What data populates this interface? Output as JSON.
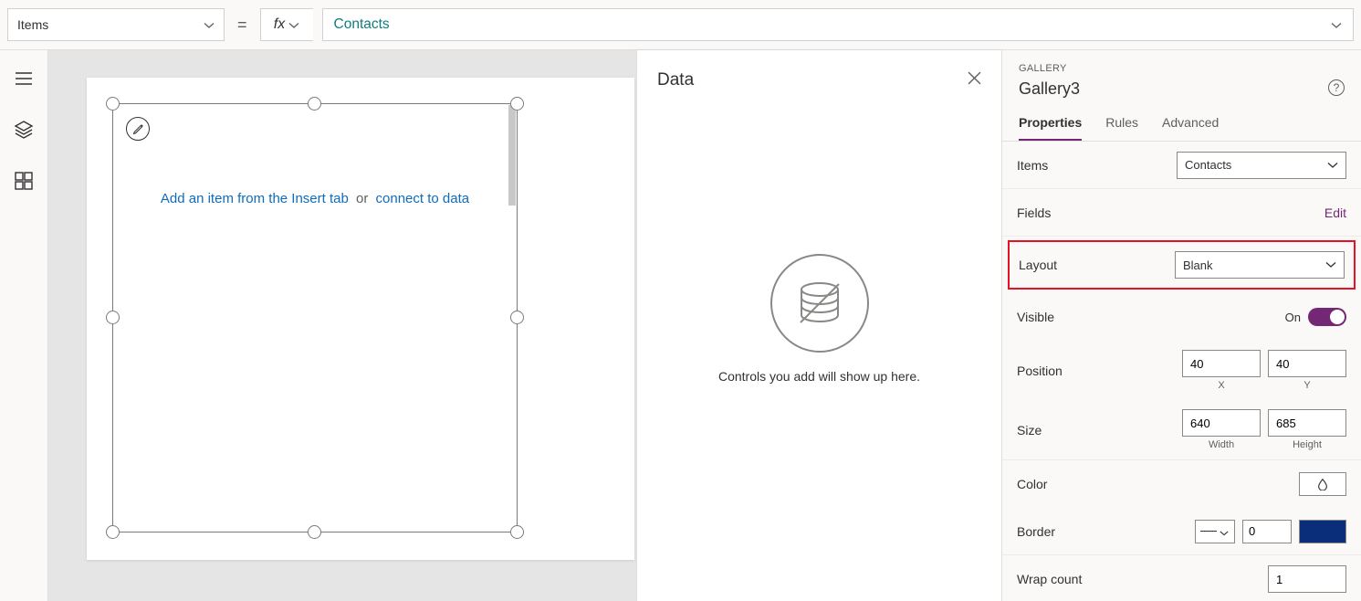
{
  "formulaBar": {
    "property": "Items",
    "equals": "=",
    "fx": "fx",
    "formula": "Contacts"
  },
  "canvas": {
    "galleryHint": {
      "left": "Add an item from the Insert tab",
      "sep": "or",
      "right": "connect to data"
    }
  },
  "dataPanel": {
    "title": "Data",
    "message": "Controls you add will show up here."
  },
  "props": {
    "category": "GALLERY",
    "name": "Gallery3",
    "tabs": {
      "properties": "Properties",
      "rules": "Rules",
      "advanced": "Advanced"
    },
    "items": {
      "label": "Items",
      "value": "Contacts"
    },
    "fields": {
      "label": "Fields",
      "edit": "Edit"
    },
    "layout": {
      "label": "Layout",
      "value": "Blank"
    },
    "visible": {
      "label": "Visible",
      "state": "On"
    },
    "position": {
      "label": "Position",
      "x": "40",
      "y": "40",
      "xlbl": "X",
      "ylbl": "Y"
    },
    "size": {
      "label": "Size",
      "w": "640",
      "h": "685",
      "wlbl": "Width",
      "hlbl": "Height"
    },
    "color": {
      "label": "Color"
    },
    "border": {
      "label": "Border",
      "value": "0"
    },
    "wrap": {
      "label": "Wrap count",
      "value": "1"
    }
  }
}
